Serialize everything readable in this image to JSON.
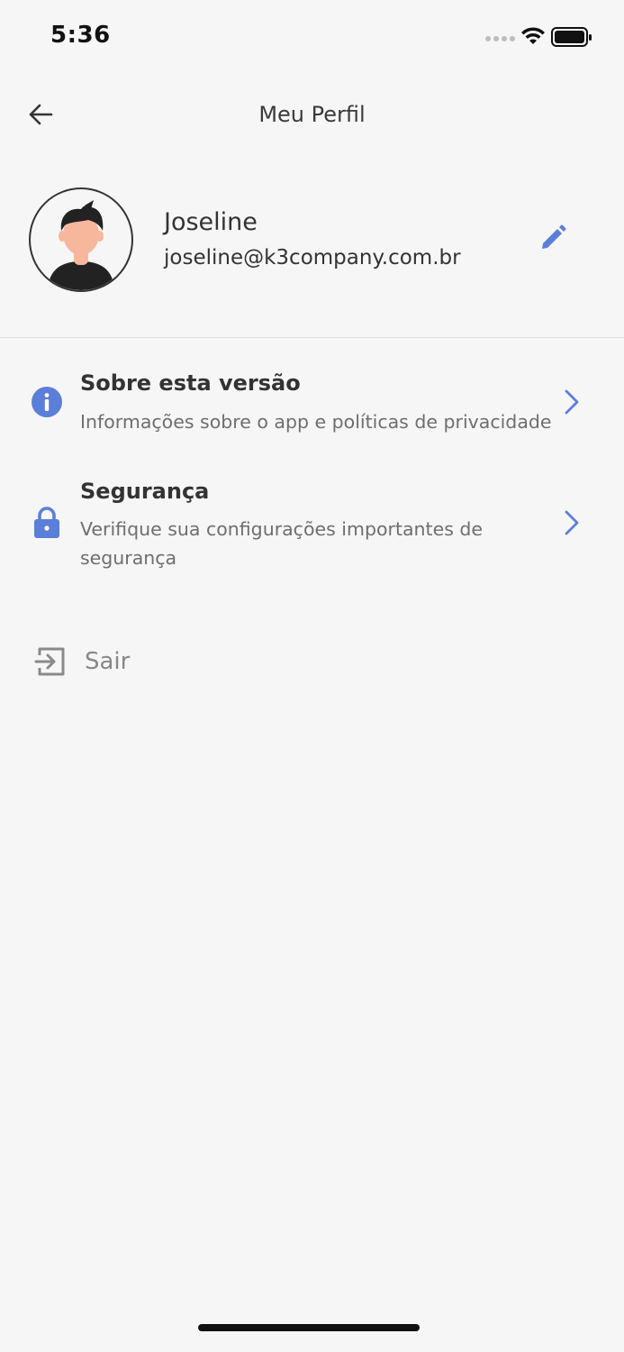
{
  "status_bar": {
    "time": "5:36"
  },
  "header": {
    "title": "Meu Perfil",
    "back_icon": "arrow-left-icon"
  },
  "profile": {
    "name": "Joseline",
    "email": "joseline@k3company.com.br",
    "edit_icon": "pencil-icon"
  },
  "menu": {
    "items": [
      {
        "title": "Sobre esta versão",
        "description": "Informações sobre o app e políticas de privacidade",
        "icon": "info-icon"
      },
      {
        "title": "Segurança",
        "description": "Verifique sua configurações importantes de segurança",
        "icon": "lock-icon"
      }
    ]
  },
  "logout": {
    "label": "Sair",
    "icon": "logout-icon"
  },
  "colors": {
    "accent": "#5b7fd9",
    "background": "#f6f6f6",
    "text": "#333333",
    "muted": "#6e6e6e"
  }
}
